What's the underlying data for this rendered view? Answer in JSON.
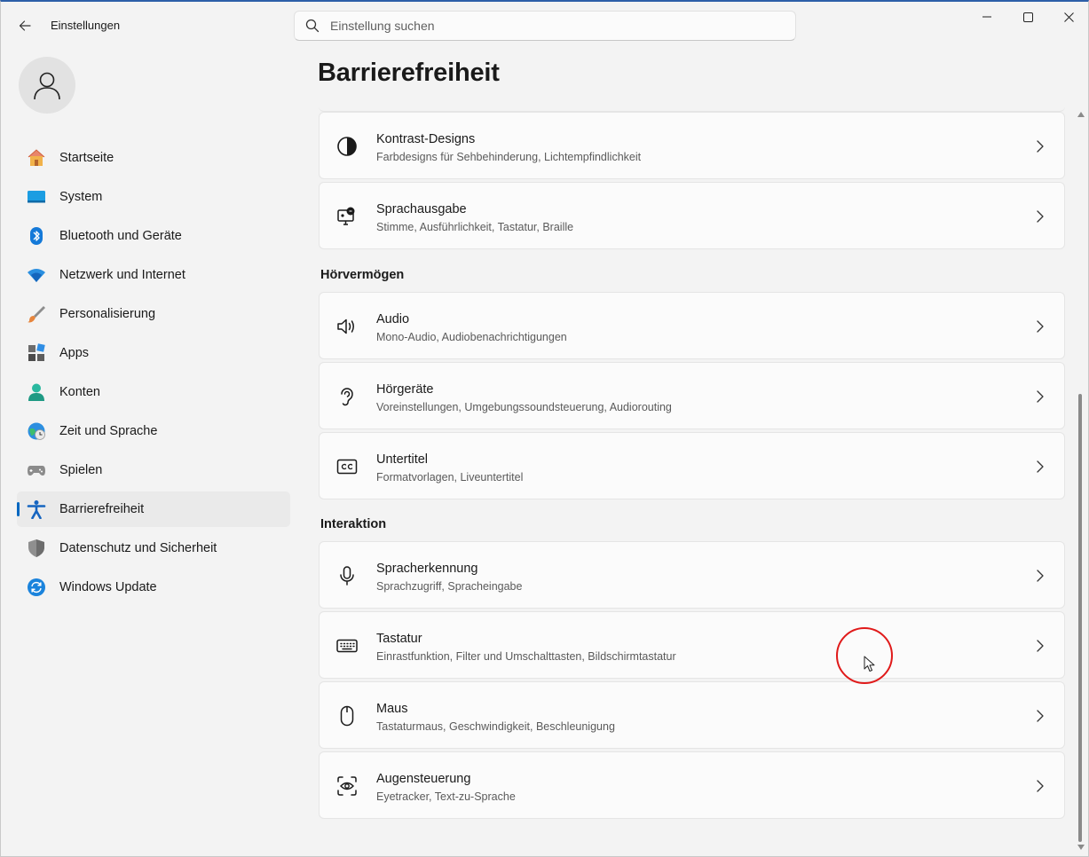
{
  "window": {
    "title": "Einstellungen",
    "accent": "#0067c0"
  },
  "search": {
    "placeholder": "Einstellung suchen",
    "value": ""
  },
  "sidebar": {
    "items": [
      {
        "label": "Startseite",
        "icon": "home-icon",
        "active": false
      },
      {
        "label": "System",
        "icon": "system-icon",
        "active": false
      },
      {
        "label": "Bluetooth und Geräte",
        "icon": "bluetooth-icon",
        "active": false
      },
      {
        "label": "Netzwerk und Internet",
        "icon": "wifi-icon",
        "active": false
      },
      {
        "label": "Personalisierung",
        "icon": "brush-icon",
        "active": false
      },
      {
        "label": "Apps",
        "icon": "apps-icon",
        "active": false
      },
      {
        "label": "Konten",
        "icon": "account-icon",
        "active": false
      },
      {
        "label": "Zeit und Sprache",
        "icon": "time-language-icon",
        "active": false
      },
      {
        "label": "Spielen",
        "icon": "gamepad-icon",
        "active": false
      },
      {
        "label": "Barrierefreiheit",
        "icon": "accessibility-icon",
        "active": true
      },
      {
        "label": "Datenschutz und Sicherheit",
        "icon": "shield-icon",
        "active": false
      },
      {
        "label": "Windows Update",
        "icon": "update-icon",
        "active": false
      }
    ]
  },
  "main": {
    "title": "Barrierefreiheit",
    "sections": {
      "vision_cards": [
        {
          "title": "Kontrast-Designs",
          "subtitle": "Farbdesigns für Sehbehinderung, Lichtempfindlichkeit",
          "icon": "contrast-icon"
        },
        {
          "title": "Sprachausgabe",
          "subtitle": "Stimme, Ausführlichkeit, Tastatur, Braille",
          "icon": "narrator-icon"
        }
      ],
      "hearing": {
        "header": "Hörvermögen",
        "cards": [
          {
            "title": "Audio",
            "subtitle": "Mono-Audio, Audiobenachrichtigungen",
            "icon": "speaker-icon"
          },
          {
            "title": "Hörgeräte",
            "subtitle": "Voreinstellungen, Umgebungssoundsteuerung, Audiorouting",
            "icon": "ear-icon"
          },
          {
            "title": "Untertitel",
            "subtitle": "Formatvorlagen, Liveuntertitel",
            "icon": "captions-icon"
          }
        ]
      },
      "interaction": {
        "header": "Interaktion",
        "cards": [
          {
            "title": "Spracherkennung",
            "subtitle": "Sprachzugriff, Spracheingabe",
            "icon": "microphone-icon"
          },
          {
            "title": "Tastatur",
            "subtitle": "Einrastfunktion, Filter und Umschalttasten, Bildschirmtastatur",
            "icon": "keyboard-icon"
          },
          {
            "title": "Maus",
            "subtitle": "Tastaturmaus, Geschwindigkeit, Beschleunigung",
            "icon": "mouse-icon"
          },
          {
            "title": "Augensteuerung",
            "subtitle": "Eyetracker, Text-zu-Sprache",
            "icon": "eye-control-icon"
          }
        ]
      }
    }
  }
}
